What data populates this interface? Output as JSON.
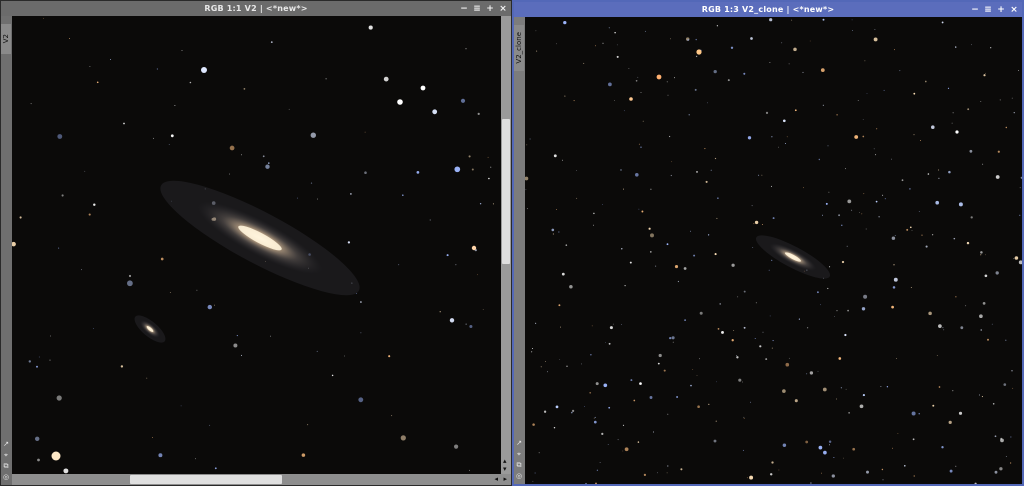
{
  "windows": [
    {
      "title": "RGB 1:1 V2 | <*new*>",
      "side_tab": "V2",
      "title_buttons": [
        "minimize-icon",
        "shade-icon",
        "maximize-icon",
        "close-icon"
      ],
      "accent": "#6b6b6b",
      "active": false
    },
    {
      "title": "RGB 1:3 V2_clone | <*new*>",
      "side_tab": "V2_clone",
      "title_buttons": [
        "minimize-icon",
        "shade-icon",
        "maximize-icon",
        "close-icon"
      ],
      "accent": "#5b6dbc",
      "active": true
    }
  ],
  "glyphs": {
    "minimize": "−",
    "shade": "≡",
    "maximize": "+",
    "close": "×",
    "scroll_up": "▴",
    "scroll_down": "▾",
    "scroll_left": "◂",
    "scroll_right": "▸",
    "strip_icons": [
      "↗",
      "⌖",
      "⧉",
      "◎"
    ]
  },
  "scroll": {
    "v2_vertical_position": 0.35,
    "v2_horizontal_position": 0.37
  },
  "colors": {
    "background": "#0a0908",
    "active_titlebar": "#5b6dbc",
    "inactive_titlebar": "#6b6b6b"
  }
}
